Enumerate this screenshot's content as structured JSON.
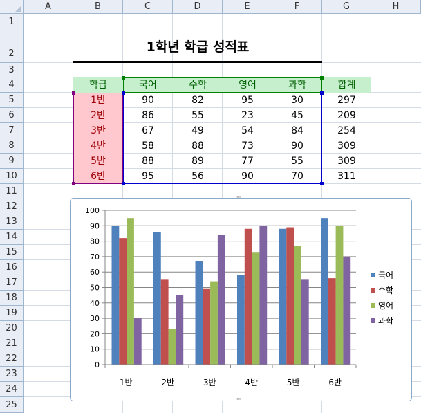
{
  "columns": [
    "A",
    "B",
    "C",
    "D",
    "E",
    "F",
    "G",
    "H"
  ],
  "rows": [
    "1",
    "2",
    "3",
    "4",
    "5",
    "6",
    "7",
    "8",
    "9",
    "10",
    "11",
    "12",
    "13",
    "14",
    "15",
    "16",
    "17",
    "18",
    "19",
    "20",
    "21",
    "22",
    "23",
    "24",
    "25"
  ],
  "title": "1학년 학급 성적표",
  "table": {
    "headers": [
      "학급",
      "국어",
      "수학",
      "영어",
      "과학",
      "합계"
    ],
    "rows": [
      {
        "class": "1반",
        "korean": "90",
        "math": "82",
        "english": "95",
        "science": "30",
        "total": "297"
      },
      {
        "class": "2반",
        "korean": "86",
        "math": "55",
        "english": "23",
        "science": "45",
        "total": "209"
      },
      {
        "class": "3반",
        "korean": "67",
        "math": "49",
        "english": "54",
        "science": "84",
        "total": "254"
      },
      {
        "class": "4반",
        "korean": "58",
        "math": "88",
        "english": "73",
        "science": "90",
        "total": "309"
      },
      {
        "class": "5반",
        "korean": "88",
        "math": "89",
        "english": "77",
        "science": "55",
        "total": "309"
      },
      {
        "class": "6반",
        "korean": "95",
        "math": "56",
        "english": "90",
        "science": "70",
        "total": "311"
      }
    ]
  },
  "colors": {
    "header_fill": "#c6efce",
    "header_text": "#006100",
    "class_fill": "#ffc7ce",
    "class_text": "#9c0006",
    "sel_green": "#008000",
    "sel_purple": "#800080",
    "sel_blue": "#0000cc"
  },
  "chart_data": {
    "type": "bar",
    "categories": [
      "1반",
      "2반",
      "3반",
      "4반",
      "5반",
      "6반"
    ],
    "series": [
      {
        "name": "국어",
        "color": "#4f81bd",
        "values": [
          90,
          86,
          67,
          58,
          88,
          95
        ]
      },
      {
        "name": "수학",
        "color": "#c0504d",
        "values": [
          82,
          55,
          49,
          88,
          89,
          56
        ]
      },
      {
        "name": "영어",
        "color": "#9bbb59",
        "values": [
          95,
          23,
          54,
          73,
          77,
          90
        ]
      },
      {
        "name": "과학",
        "color": "#8064a2",
        "values": [
          30,
          45,
          84,
          90,
          55,
          70
        ]
      }
    ],
    "ylim": [
      0,
      100
    ],
    "yticks": [
      0,
      10,
      20,
      30,
      40,
      50,
      60,
      70,
      80,
      90,
      100
    ],
    "grid": true,
    "legend": "right"
  }
}
